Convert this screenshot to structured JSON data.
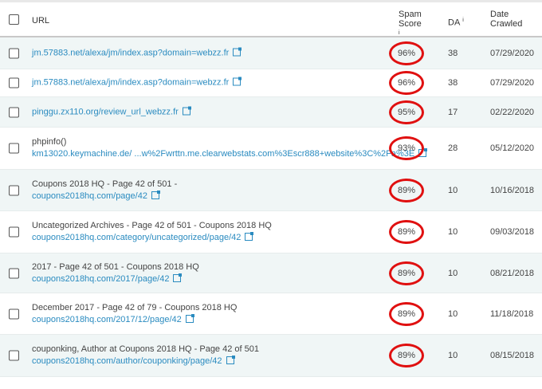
{
  "header": {
    "url": "URL",
    "spam_score": "Spam Score",
    "spam_info": "i",
    "da": "DA",
    "da_info": "i",
    "date_crawled": "Date Crawled"
  },
  "rows": [
    {
      "title": "",
      "url": "jm.57883.net/alexa/jm/index.asp?domain=webzz.fr",
      "spam": "96%",
      "da": "38",
      "date": "07/29/2020"
    },
    {
      "title": "",
      "url": "jm.57883.net/alexa/jm/index.asp?domain=webzz.fr",
      "spam": "96%",
      "da": "38",
      "date": "07/29/2020"
    },
    {
      "title": "",
      "url": "pinggu.zx110.org/review_url_webzz.fr",
      "spam": "95%",
      "da": "17",
      "date": "02/22/2020"
    },
    {
      "title": "phpinfo()",
      "url": "km13020.keymachine.de/  ...w%2Fwrttn.me.clearwebstats.com%3Escr888+website%3C%2Fa%3E",
      "spam": "93%",
      "da": "28",
      "date": "05/12/2020"
    },
    {
      "title": "Coupons 2018 HQ - Page 42 of 501 -",
      "url": "coupons2018hq.com/page/42",
      "spam": "89%",
      "da": "10",
      "date": "10/16/2018"
    },
    {
      "title": "Uncategorized Archives - Page 42 of 501 - Coupons 2018 HQ",
      "url": "coupons2018hq.com/category/uncategorized/page/42",
      "spam": "89%",
      "da": "10",
      "date": "09/03/2018"
    },
    {
      "title": "2017 - Page 42 of 501 - Coupons 2018 HQ",
      "url": "coupons2018hq.com/2017/page/42",
      "spam": "89%",
      "da": "10",
      "date": "08/21/2018"
    },
    {
      "title": "December 2017 - Page 42 of 79 - Coupons 2018 HQ",
      "url": "coupons2018hq.com/2017/12/page/42",
      "spam": "89%",
      "da": "10",
      "date": "11/18/2018"
    },
    {
      "title": "couponking, Author at Coupons 2018 HQ - Page 42 of 501",
      "url": "coupons2018hq.com/author/couponking/page/42",
      "spam": "89%",
      "da": "10",
      "date": "08/15/2018"
    }
  ]
}
